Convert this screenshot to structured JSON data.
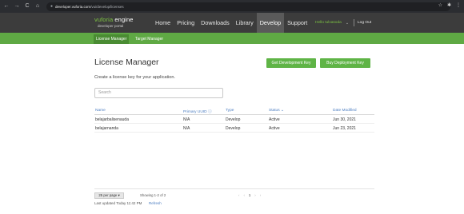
{
  "browser": {
    "back": "←",
    "forward": "→",
    "reload": "C",
    "home": "⌂",
    "lock": "●",
    "url_host": "developer.vuforia.com",
    "url_path": "/vui/develop/licenses",
    "star": "☆",
    "ext": "✱",
    "menu": "⋮"
  },
  "header": {
    "logo_brand": "vuforia",
    "logo_word": " engine",
    "logo_sub": "developer portal",
    "nav": [
      "Home",
      "Pricing",
      "Downloads",
      "Library",
      "Develop",
      "Support"
    ],
    "active_nav": "Develop",
    "user": "Hello tulvasoda",
    "user_caret": "⌄",
    "logout": "Log Out"
  },
  "subnav": {
    "items": [
      "License Manager",
      "Target Manager"
    ],
    "active": "License Manager"
  },
  "main": {
    "title": "License Manager",
    "btn_dev": "Get Development Key",
    "btn_deploy": "Buy Deployment Key",
    "subtitle": "Create a license key for your application.",
    "search_placeholder": "Search"
  },
  "table": {
    "headers": [
      "Name",
      "Primary UUID ⓘ",
      "Type",
      "Status ⌄",
      "Date Modified"
    ],
    "rows": [
      [
        "belajarbalisenauda",
        "N/A",
        "Develop",
        "Active",
        "Jun 30, 2021"
      ],
      [
        "belajarnanda",
        "N/A",
        "Develop",
        "Active",
        "Jun 23, 2021"
      ]
    ]
  },
  "footer": {
    "per_page": "25 per page ▾",
    "showing": "Showing 1-2 of 2",
    "pager_prev": "‹",
    "pager_prev2": "‹",
    "pager_cur": "1",
    "pager_next": "›",
    "pager_next2": "›",
    "last_updated": "Last updated Today 11:42 PM",
    "refresh": "Refresh"
  }
}
